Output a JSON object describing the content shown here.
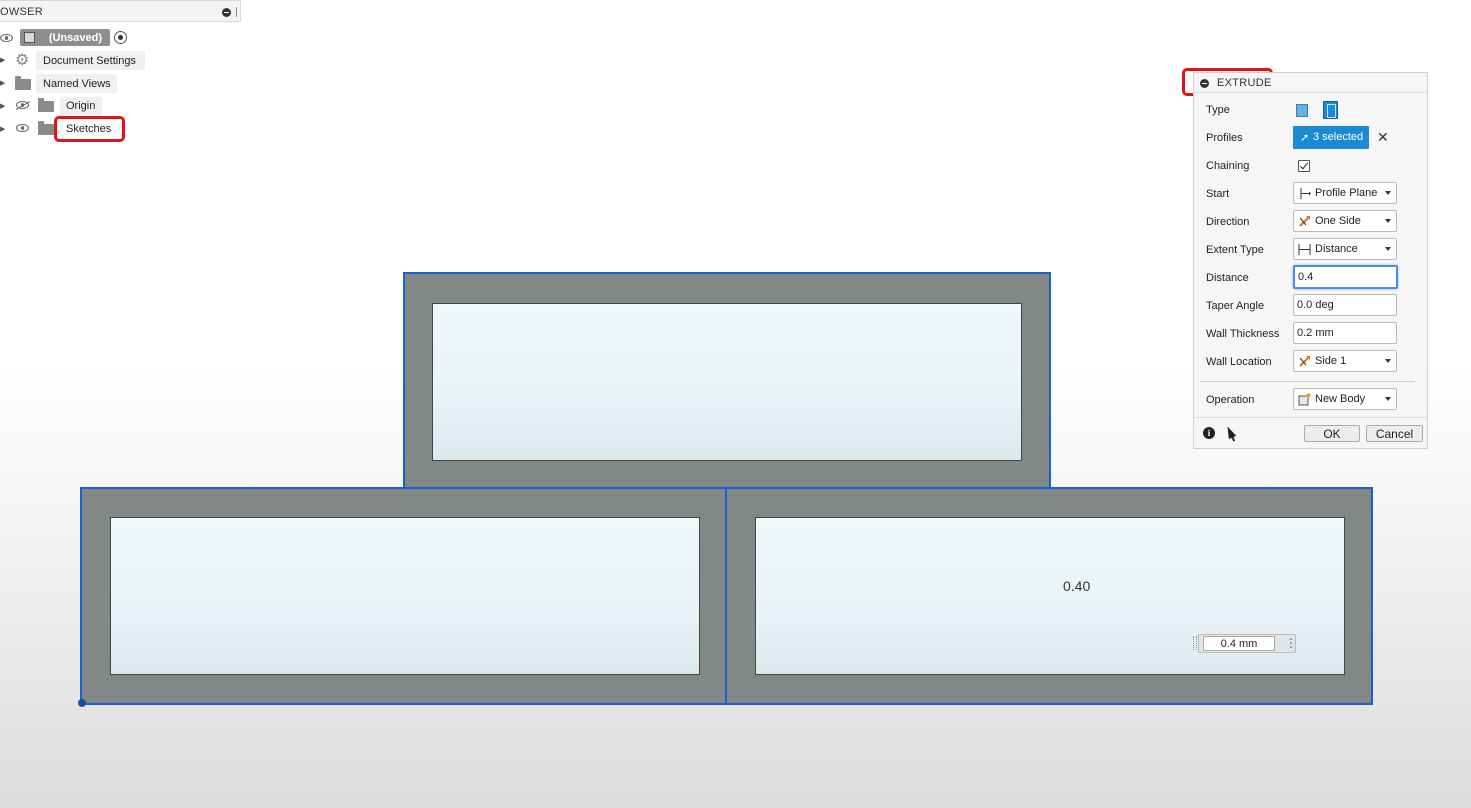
{
  "browser": {
    "header": "OWSER",
    "items": [
      {
        "label": "(Unsaved)"
      },
      {
        "label": "Document Settings"
      },
      {
        "label": "Named Views"
      },
      {
        "label": "Origin"
      },
      {
        "label": "Sketches"
      }
    ]
  },
  "canvas": {
    "dimension_label": "0.40",
    "dimension_input": "0.4 mm"
  },
  "extrude": {
    "title": "EXTRUDE",
    "rows": {
      "type": "Type",
      "profiles": "Profiles",
      "profiles_value": "3 selected",
      "chaining": "Chaining",
      "start": "Start",
      "start_value": "Profile Plane",
      "direction": "Direction",
      "direction_value": "One Side",
      "extent_type": "Extent Type",
      "extent_type_value": "Distance",
      "distance": "Distance",
      "distance_value": "0.4",
      "taper_angle": "Taper Angle",
      "taper_angle_value": "0.0 deg",
      "wall_thickness": "Wall Thickness",
      "wall_thickness_value": "0.2 mm",
      "wall_location": "Wall Location",
      "wall_location_value": "Side 1",
      "operation": "Operation",
      "operation_value": "New Body"
    },
    "ok_label": "OK",
    "cancel_label": "Cancel"
  },
  "colors": {
    "selection_blue": "#1a5fd0",
    "accent": "#1a8ad4",
    "highlight_red": "#e01414"
  }
}
